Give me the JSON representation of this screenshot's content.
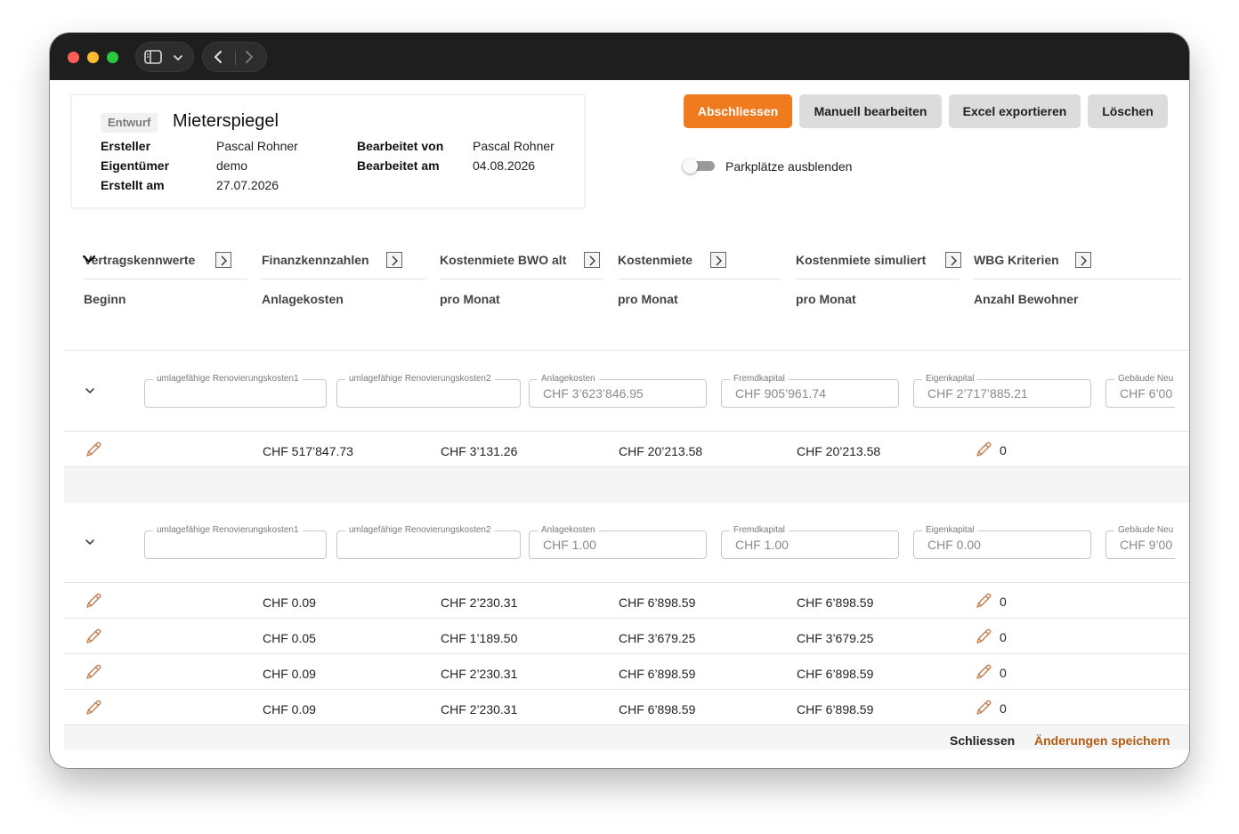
{
  "window": {
    "icons": {
      "sidebar": "sidebar-toggle-icon",
      "dropdown": "chevron-down-icon",
      "back": "chevron-left-icon",
      "forward": "chevron-right-icon"
    }
  },
  "card": {
    "badge": "Entwurf",
    "title": "Mieterspiegel",
    "creator_label": "Ersteller",
    "creator": "Pascal Rohner",
    "owner_label": "Eigentümer",
    "owner": "demo",
    "created_label": "Erstellt am",
    "created": "27.07.2026",
    "edited_by_label": "Bearbeitet von",
    "edited_by": "Pascal Rohner",
    "edited_at_label": "Bearbeitet am",
    "edited_at": "04.08.2026"
  },
  "actions": {
    "finish": "Abschliessen",
    "manual_edit": "Manuell bearbeiten",
    "export_excel": "Excel exportieren",
    "delete": "Löschen",
    "accent_color": "#f07a1e"
  },
  "toggle": {
    "label": "Parkplätze ausblenden",
    "on": false
  },
  "columns": [
    {
      "title": "Vertragskennwerte",
      "sub": "Beginn"
    },
    {
      "title": "Finanzkennzahlen",
      "sub": "Anlagekosten"
    },
    {
      "title": "Kostenmiete BWO alt",
      "sub": "pro Monat"
    },
    {
      "title": "Kostenmiete",
      "sub": "pro Monat"
    },
    {
      "title": "Kostenmiete simuliert",
      "sub": "pro Monat"
    },
    {
      "title": "WBG Kriterien",
      "sub": "Anzahl Bewohner"
    }
  ],
  "groups": [
    {
      "fields": [
        {
          "label": "umlagefähige Renovierungskosten1",
          "value": ""
        },
        {
          "label": "umlagefähige Renovierungskosten2",
          "value": ""
        },
        {
          "label": "Anlagekosten",
          "value": "CHF 3’623’846.95"
        },
        {
          "label": "Fremdkapital",
          "value": "CHF 905’961.74"
        },
        {
          "label": "Eigenkapital",
          "value": "CHF 2’717’885.21"
        },
        {
          "label": "Gebäude Neu",
          "value": "CHF 6’00"
        }
      ],
      "rows": [
        {
          "anlagekosten": "CHF 517’847.73",
          "bwo_alt": "CHF 3’131.26",
          "kostenmiete": "CHF 20’213.58",
          "simuliert": "CHF 20’213.58",
          "bewohner": "0"
        }
      ]
    },
    {
      "fields": [
        {
          "label": "umlagefähige Renovierungskosten1",
          "value": ""
        },
        {
          "label": "umlagefähige Renovierungskosten2",
          "value": ""
        },
        {
          "label": "Anlagekosten",
          "value": "CHF 1.00"
        },
        {
          "label": "Fremdkapital",
          "value": "CHF 1.00"
        },
        {
          "label": "Eigenkapital",
          "value": "CHF 0.00"
        },
        {
          "label": "Gebäude Neu",
          "value": "CHF 9’00"
        }
      ],
      "rows": [
        {
          "anlagekosten": "CHF 0.09",
          "bwo_alt": "CHF 2’230.31",
          "kostenmiete": "CHF 6’898.59",
          "simuliert": "CHF 6’898.59",
          "bewohner": "0"
        },
        {
          "anlagekosten": "CHF 0.05",
          "bwo_alt": "CHF 1’189.50",
          "kostenmiete": "CHF 3’679.25",
          "simuliert": "CHF 3’679.25",
          "bewohner": "0"
        },
        {
          "anlagekosten": "CHF 0.09",
          "bwo_alt": "CHF 2’230.31",
          "kostenmiete": "CHF 6’898.59",
          "simuliert": "CHF 6’898.59",
          "bewohner": "0"
        },
        {
          "anlagekosten": "CHF 0.09",
          "bwo_alt": "CHF 2’230.31",
          "kostenmiete": "CHF 6’898.59",
          "simuliert": "CHF 6’898.59",
          "bewohner": "0"
        }
      ]
    }
  ],
  "footer": {
    "close": "Schliessen",
    "save": "Änderungen speichern",
    "save_color": "#b35a10"
  }
}
